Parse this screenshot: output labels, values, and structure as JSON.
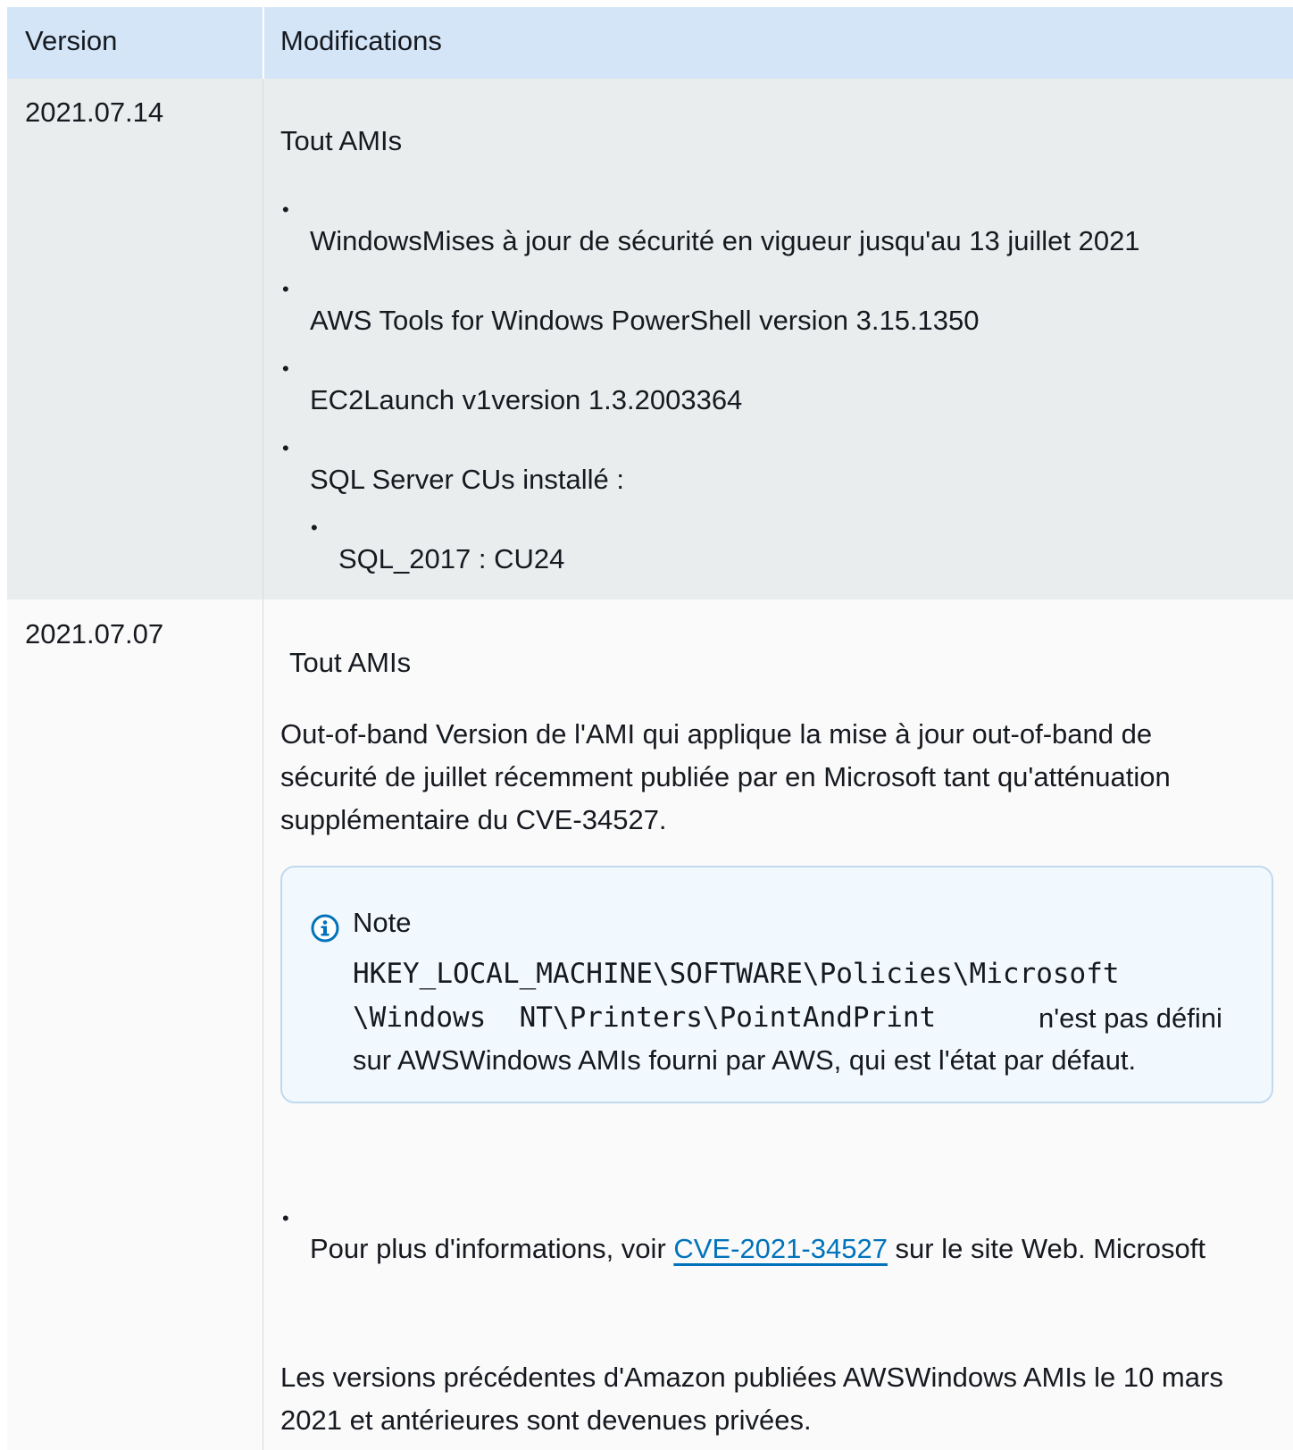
{
  "header": {
    "version": "Version",
    "modifications": "Modifications"
  },
  "row1": {
    "version": "2021.07.14",
    "title": "Tout AMIs",
    "items": [
      "WindowsMises à jour de sécurité en vigueur jusqu'au 13 juillet 2021",
      "AWS Tools for Windows PowerShell version 3.15.1350",
      "EC2Launch v1version 1.3.2003364",
      "SQL Server CUs installé :"
    ],
    "subitem": "SQL_2017 : CU24"
  },
  "row2": {
    "version": "2021.07.07",
    "title": "Tout AMIs",
    "paragraph_lines": [
      "Out-of-band Version de l'AMI qui applique la mise à jour out-of-band de",
      "sécurité de juillet récemment publiée par en Microsoft tant qu'atténuation",
      "supplémentaire du CVE-34527."
    ],
    "note": {
      "icon": "info-icon",
      "title": "Note",
      "code_line1": "HKEY_LOCAL_MACHINE\\SOFTWARE\\Policies\\Microsoft",
      "code_line2": "\\Windows  NT\\Printers\\PointAndPrint",
      "text_after_code": "n'est pas défini",
      "text_line3": "sur AWSWindows AMIs fourni par AWS, qui est l'état par défaut."
    },
    "more_info": {
      "before": "Pour plus d'informations, voir ",
      "link": "CVE-2021-34527",
      "after": " sur le site Web. Microsoft"
    },
    "final_lines": [
      "Les versions précédentes d'Amazon publiées AWSWindows AMIs le 10 mars",
      "2021 et antérieures sont devenues privées."
    ]
  }
}
